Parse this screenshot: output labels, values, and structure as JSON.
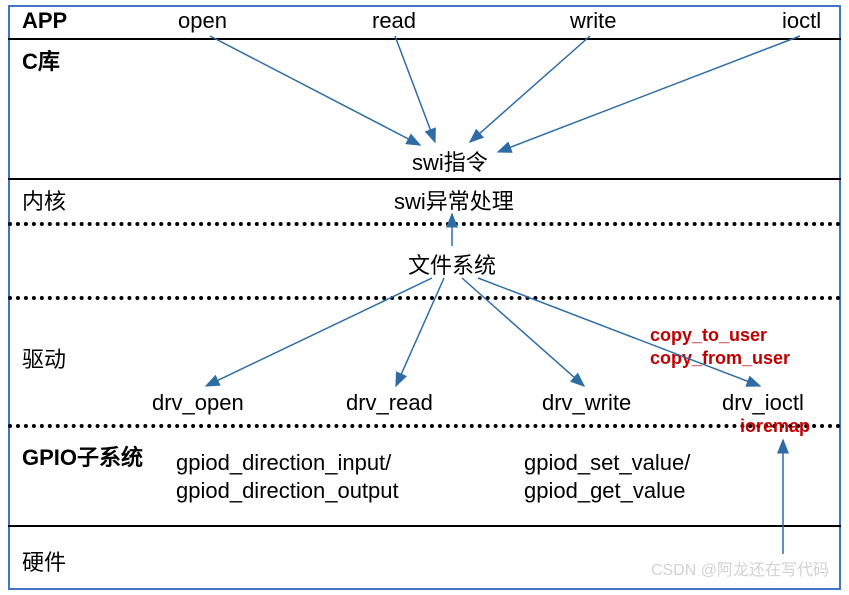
{
  "layers": {
    "app": "APP",
    "clib": "C库",
    "kernel": "内核",
    "driver": "驱动",
    "gpio": "GPIO子系统",
    "hardware": "硬件"
  },
  "syscalls": {
    "open": "open",
    "read": "read",
    "write": "write",
    "ioctl": "ioctl"
  },
  "swi": {
    "instruction": "swi指令",
    "handler": "swi异常处理"
  },
  "filesystem": "文件系统",
  "drv": {
    "open": "drv_open",
    "read": "drv_read",
    "write": "drv_write",
    "ioctl": "drv_ioctl"
  },
  "copy": {
    "to": "copy_to_user",
    "from": "copy_from_user"
  },
  "ioremap": "ioremap",
  "gpio_funcs": {
    "dir_in": "gpiod_direction_input/",
    "dir_out": "gpiod_direction_output",
    "set": "gpiod_set_value/",
    "get": "gpiod_get_value"
  },
  "watermark": "CSDN @阿龙还在写代码"
}
